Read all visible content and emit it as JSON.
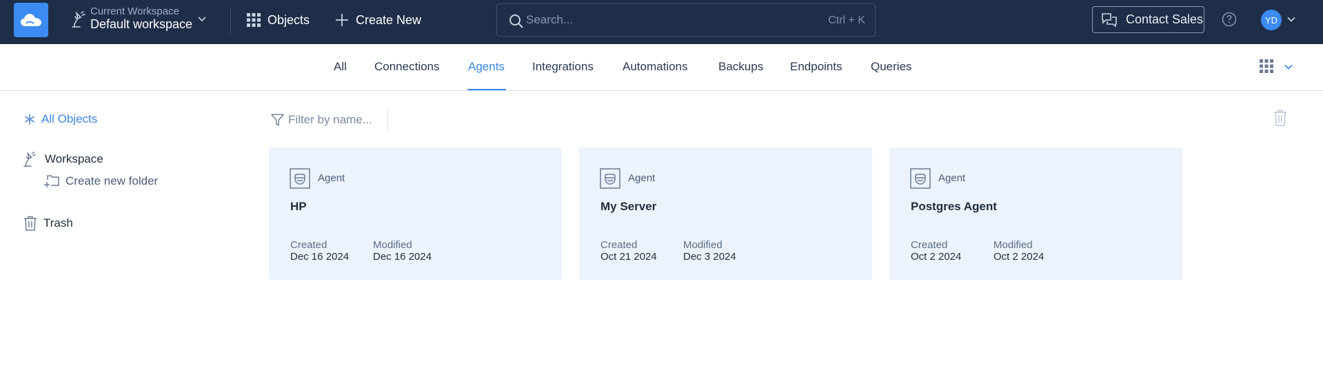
{
  "colors": {
    "topbar_bg": "#1e2d48",
    "accent": "#3a86e8",
    "card_bg": "#edf3fd"
  },
  "topbar": {
    "logo_icon": "cloud-icon",
    "workspace_caption": "Current Workspace",
    "workspace_name": "Default workspace",
    "objects_label": "Objects",
    "create_label": "Create New",
    "search_placeholder": "Search...",
    "search_shortcut": "Ctrl + K",
    "contact_label": "Contact Sales",
    "avatar_initials": "YD"
  },
  "tabs": [
    {
      "label": "All",
      "active": false
    },
    {
      "label": "Connections",
      "active": false
    },
    {
      "label": "Agents",
      "active": true
    },
    {
      "label": "Integrations",
      "active": false
    },
    {
      "label": "Automations",
      "active": false
    },
    {
      "label": "Backups",
      "active": false
    },
    {
      "label": "Endpoints",
      "active": false
    },
    {
      "label": "Queries",
      "active": false
    }
  ],
  "sidebar": {
    "all_objects": "All Objects",
    "workspace": "Workspace",
    "create_folder": "Create new folder",
    "trash": "Trash"
  },
  "filter": {
    "placeholder": "Filter by name..."
  },
  "cards": [
    {
      "type": "Agent",
      "name": "HP",
      "created_label": "Created",
      "created": "Dec 16 2024",
      "modified_label": "Modified",
      "modified": "Dec 16 2024"
    },
    {
      "type": "Agent",
      "name": "My Server",
      "created_label": "Created",
      "created": "Oct 21 2024",
      "modified_label": "Modified",
      "modified": "Dec 3 2024"
    },
    {
      "type": "Agent",
      "name": "Postgres Agent",
      "created_label": "Created",
      "created": "Oct 2 2024",
      "modified_label": "Modified",
      "modified": "Oct 2 2024"
    }
  ]
}
